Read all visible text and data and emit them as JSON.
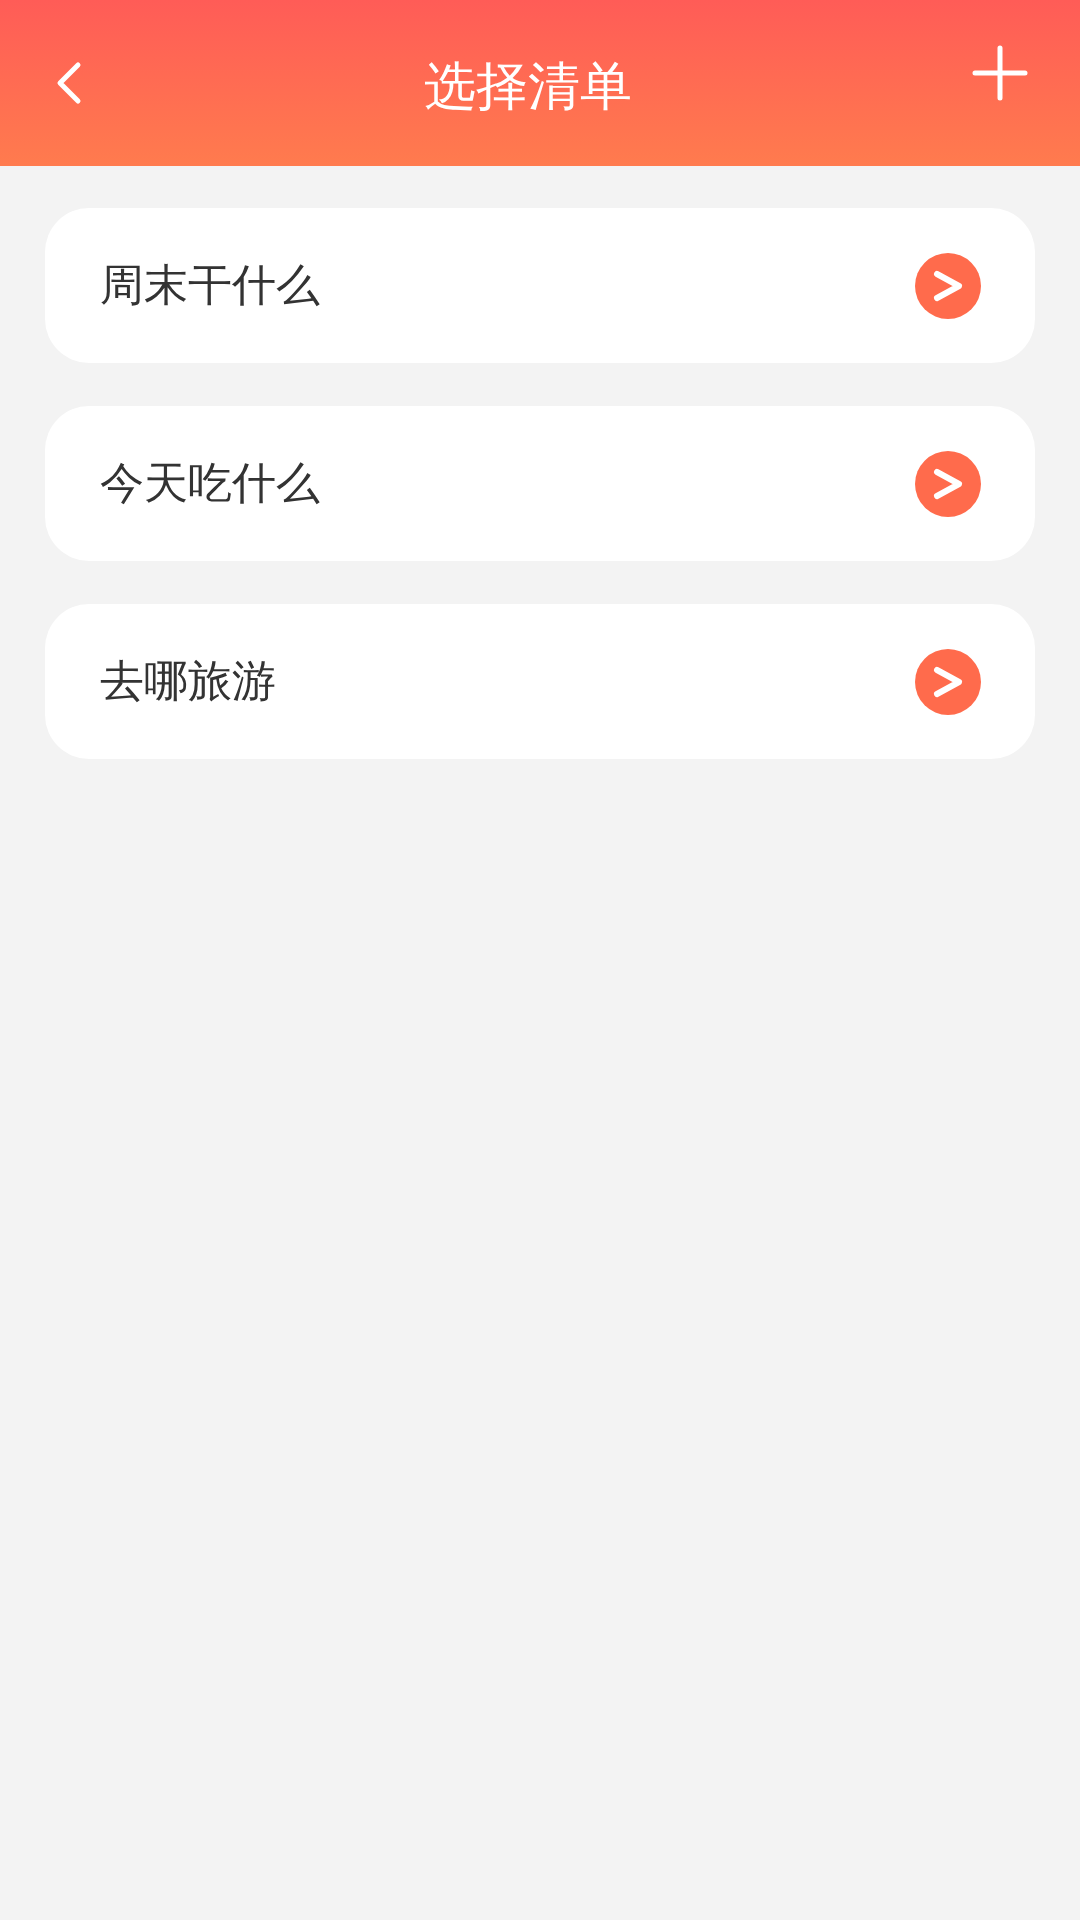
{
  "header": {
    "title": "选择清单"
  },
  "lists": [
    {
      "name": "周末干什么"
    },
    {
      "name": "今天吃什么"
    },
    {
      "name": "去哪旅游"
    }
  ]
}
